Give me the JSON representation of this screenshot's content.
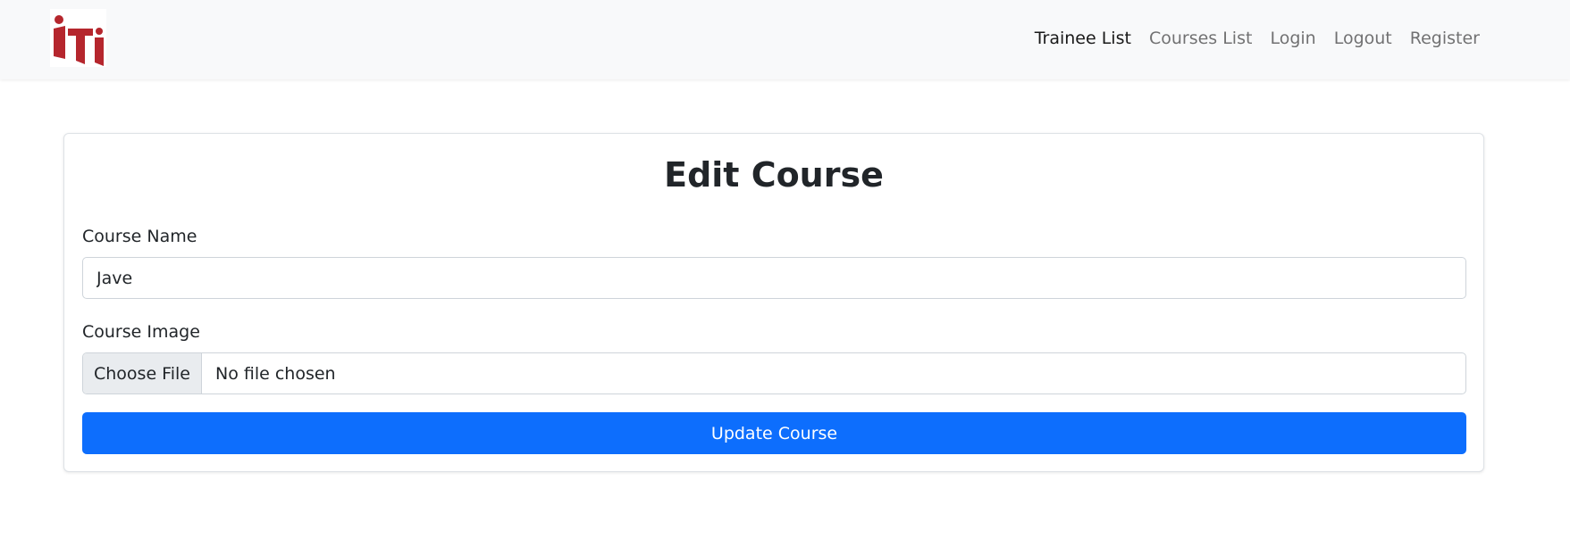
{
  "navbar": {
    "logo_icon": "iti-logo-icon",
    "logo_color": "#b5262d",
    "links": [
      {
        "label": "Trainee List",
        "active": true
      },
      {
        "label": "Courses List",
        "active": false
      },
      {
        "label": "Login",
        "active": false
      },
      {
        "label": "Logout",
        "active": false
      },
      {
        "label": "Register",
        "active": false
      }
    ]
  },
  "form": {
    "title": "Edit Course",
    "course_name_label": "Course Name",
    "course_name_value": "Jave",
    "course_image_label": "Course Image",
    "choose_file_label": "Choose File",
    "file_status": "No file chosen",
    "submit_label": "Update Course"
  },
  "colors": {
    "primary": "#0d6efd",
    "navbar_bg": "#f8f9fa"
  }
}
